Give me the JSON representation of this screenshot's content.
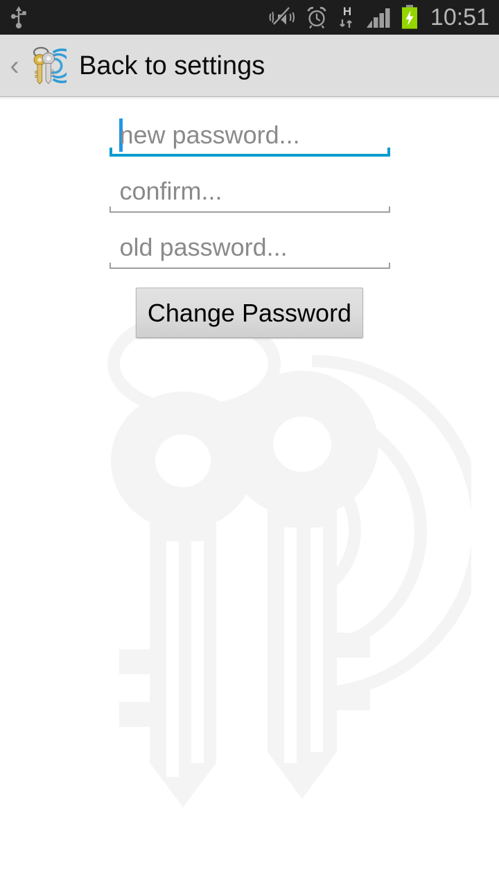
{
  "status_bar": {
    "icons": [
      "usb-icon",
      "volume-mute-vibrate-icon",
      "alarm-clock-icon",
      "hspa-data-icon",
      "signal-bars-icon",
      "battery-charging-icon"
    ],
    "network_type": "H",
    "clock": "10:51",
    "background_color": "#1d1d1d",
    "icon_color": "#9e9e9e",
    "clock_color": "#b6b6b6",
    "battery_color": "#95d600"
  },
  "action_bar": {
    "back_label": "‹",
    "app_icon": "keepass-keys-icon",
    "title": "Back to settings",
    "background_color": "#dedede",
    "title_color": "#0b0b0b"
  },
  "form": {
    "fields": [
      {
        "name": "new-password",
        "placeholder": "new password...",
        "value": "",
        "focused": true,
        "underline_color": "#049ccf"
      },
      {
        "name": "confirm-password",
        "placeholder": "confirm...",
        "value": "",
        "focused": false,
        "underline_color": "#9e9e9e"
      },
      {
        "name": "old-password",
        "placeholder": "old password...",
        "value": "",
        "focused": false,
        "underline_color": "#9e9e9e"
      }
    ],
    "submit_label": "Change Password",
    "placeholder_color": "#8a8a8a",
    "caret_color": "#2196e8"
  },
  "background": {
    "watermark": "keepass-keys-watermark",
    "page_color": "#ffffff"
  }
}
